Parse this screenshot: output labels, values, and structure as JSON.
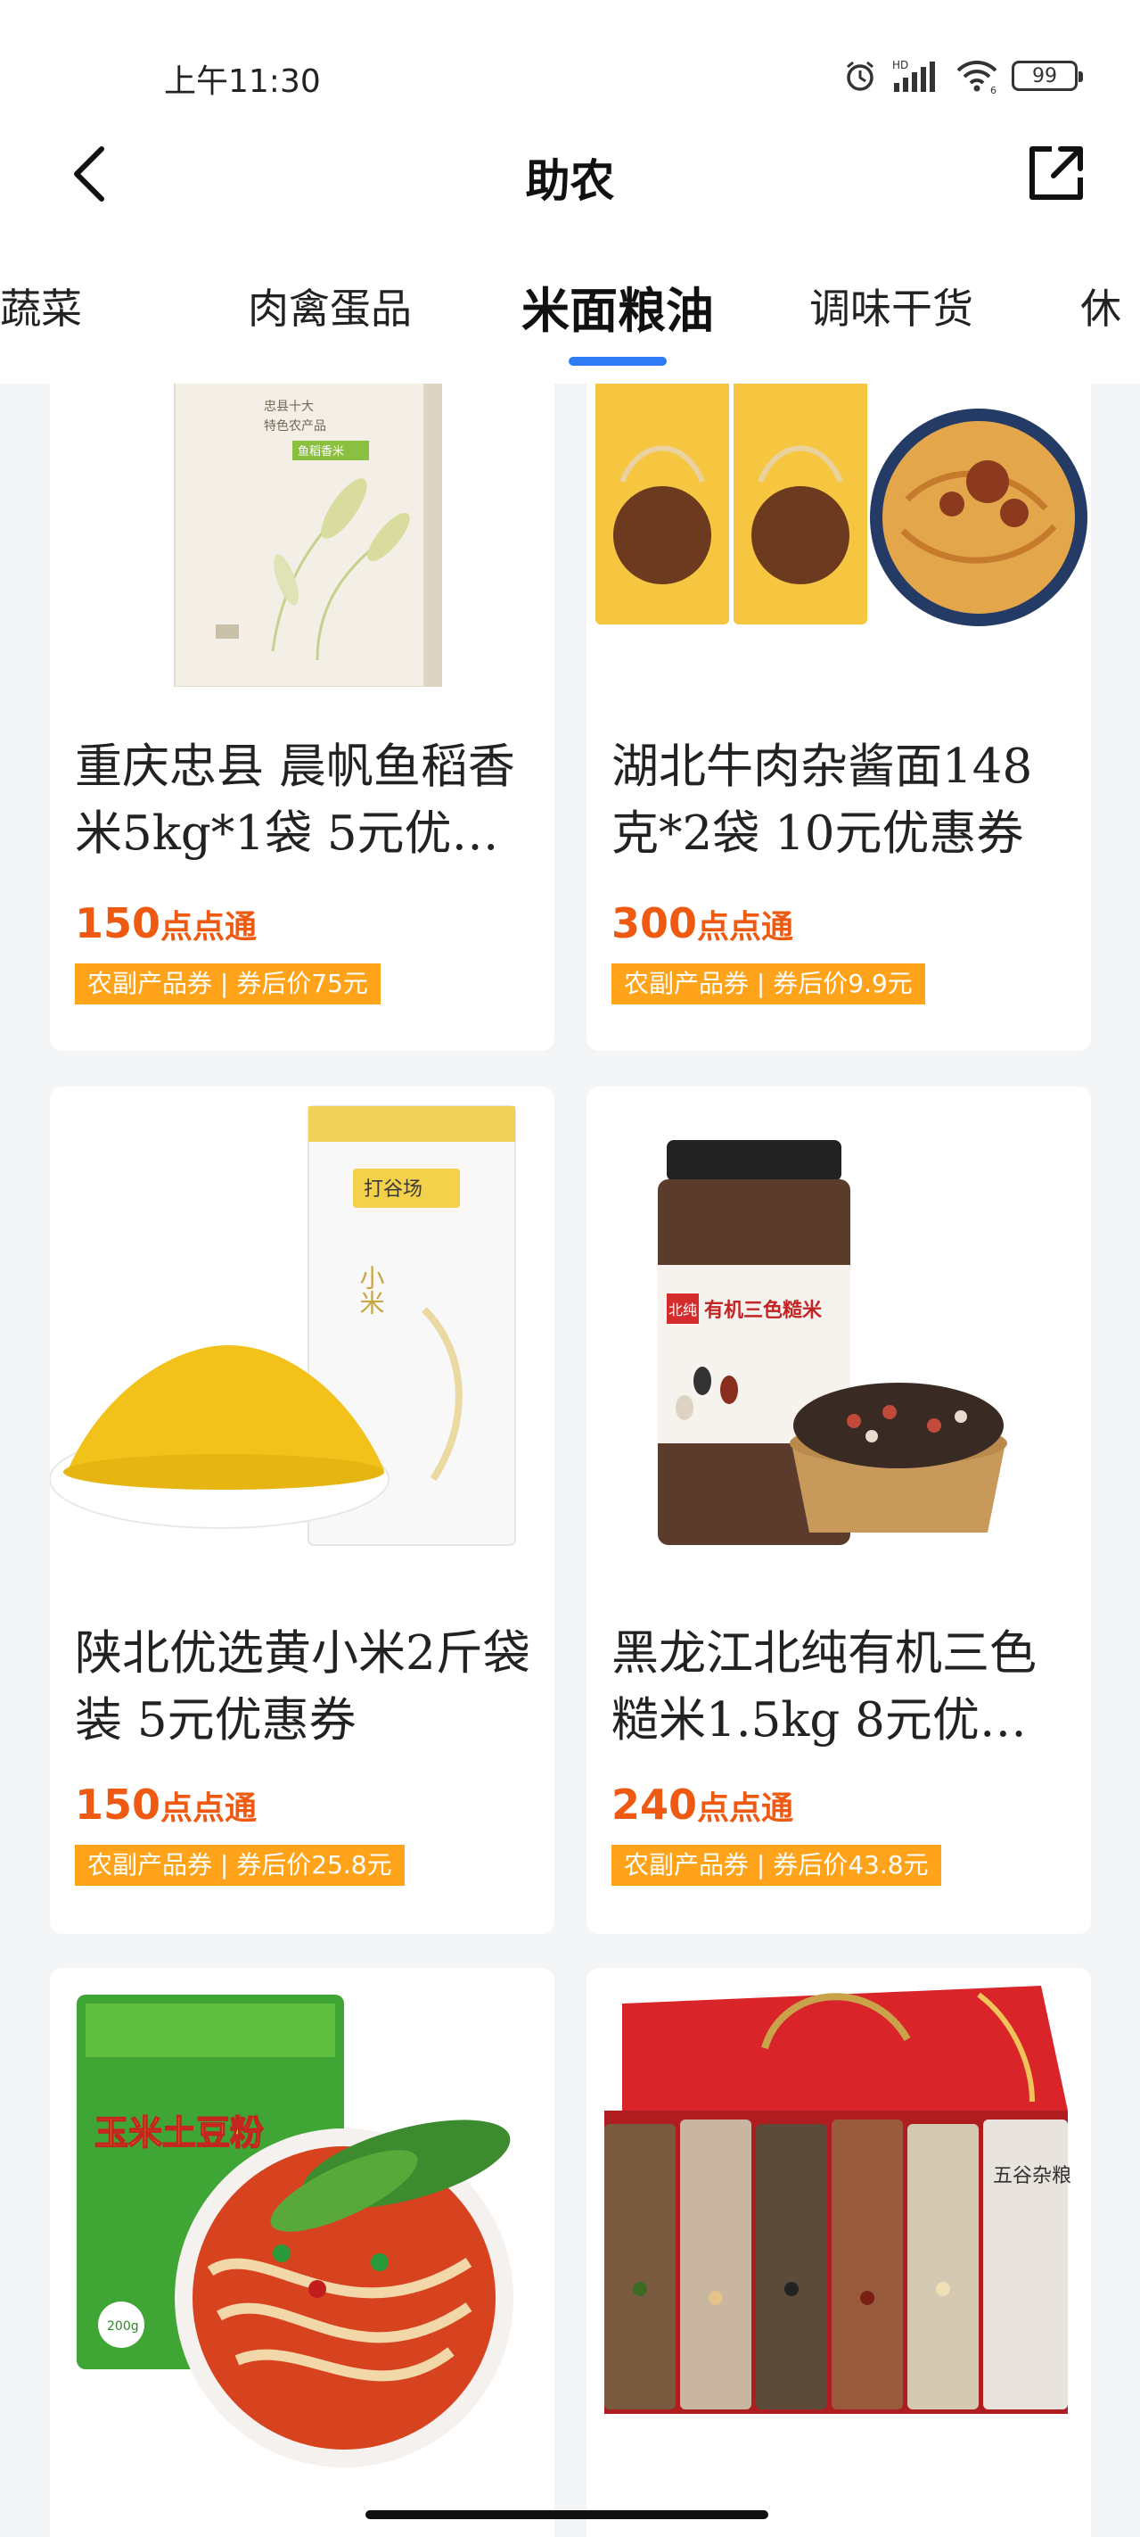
{
  "status_bar": {
    "time": "上午11:30",
    "hd": "HD",
    "wifi_num": "6",
    "battery": "99"
  },
  "header": {
    "title": "助农"
  },
  "tabs": [
    {
      "label": "果蔬菜"
    },
    {
      "label": "肉禽蛋品"
    },
    {
      "label": "米面粮油",
      "active": true
    },
    {
      "label": "调味干货"
    },
    {
      "label": "休"
    }
  ],
  "products": [
    {
      "name": "重庆忠县 晨帆鱼稻香米5kg*1袋 5元优…",
      "price": "150",
      "unit": "点点通",
      "tag": "农副产品券 | 券后价75元",
      "image": "rice-bag",
      "image_text": {
        "line1": "忠县十大",
        "line2": "特色农产品",
        "line3": "鱼稻香米"
      }
    },
    {
      "name": "湖北牛肉杂酱面148克*2袋 10元优惠券",
      "price": "300",
      "unit": "点点通",
      "tag": "农副产品券 | 券后价9.9元",
      "image": "noodle-packs"
    },
    {
      "name": "陕北优选黄小米2斤袋装 5元优惠券",
      "price": "150",
      "unit": "点点通",
      "tag": "农副产品券 | 券后价25.8元",
      "image": "millet",
      "image_text": {
        "brand": "打谷场",
        "product": "小米"
      }
    },
    {
      "name": "黑龙江北纯有机三色糙米1.5kg 8元优…",
      "price": "240",
      "unit": "点点通",
      "tag": "农副产品券 | 券后价43.8元",
      "image": "tricolor-rice-jar",
      "image_text": {
        "brand": "北纯",
        "product": "有机三色糙米"
      }
    },
    {
      "name": "",
      "price": "",
      "unit": "",
      "tag": "",
      "image": "corn-potato-noodles",
      "image_text": {
        "product": "玉米土豆粉",
        "weight": "200g"
      }
    },
    {
      "name": "",
      "price": "",
      "unit": "",
      "tag": "",
      "image": "grain-gift-box",
      "image_text": {
        "pack": "五谷杂粮"
      }
    }
  ],
  "colors": {
    "accent_blue": "#2f7bf5",
    "price_orange": "#ee5a12",
    "tag_orange": "#ffa31a"
  }
}
